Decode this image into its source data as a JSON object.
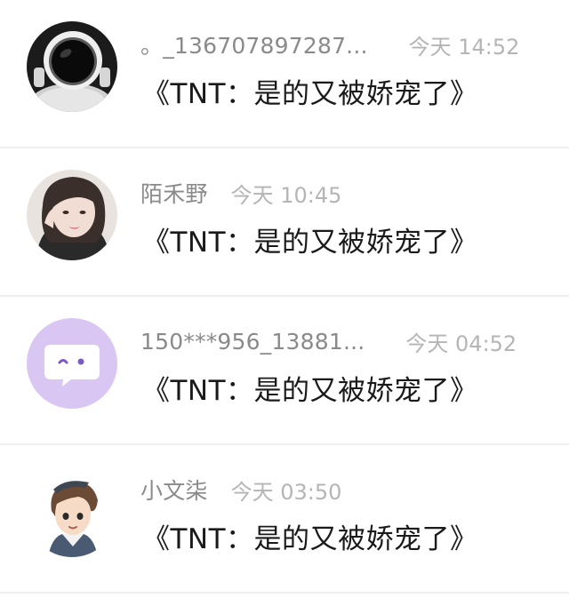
{
  "comments": [
    {
      "username": "。_136707897287...",
      "time": "今天 14:52",
      "message": "《TNT：是的又被娇宠了》",
      "avatar": "astronaut-avatar"
    },
    {
      "username": "陌禾野",
      "time": "今天 10:45",
      "message": "《TNT：是的又被娇宠了》",
      "avatar": "girl-photo-avatar"
    },
    {
      "username": "150***956_13881...",
      "time": "今天 04:52",
      "message": "《TNT：是的又被娇宠了》",
      "avatar": "default-chat-bubble-avatar"
    },
    {
      "username": "小文柒",
      "time": "今天 03:50",
      "message": "《TNT：是的又被娇宠了》",
      "avatar": "cartoon-boy-avatar"
    }
  ],
  "colors": {
    "username": "#8a8a8a",
    "time": "#b5b5b5",
    "message": "#1a1a1a",
    "divider": "#efefef",
    "default_avatar_bg": "#d9c6f2"
  }
}
